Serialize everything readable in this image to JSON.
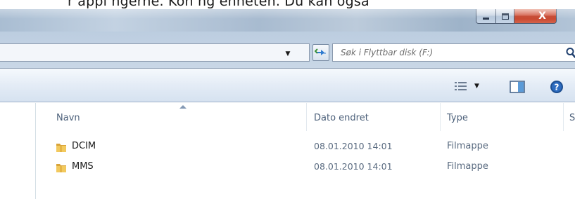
{
  "caption": {
    "text": "r appl ngerne. Kon ng enheten. Du kan også",
    "partial": true
  },
  "window": {
    "minimize_glyph": "minimize-icon",
    "maximize_glyph": "maximize-icon",
    "close_label": "X"
  },
  "address": {
    "path": ""
  },
  "search": {
    "placeholder": "Søk i Flyttbar disk (F:)"
  },
  "toolbar": {
    "views_icon": "views-icon",
    "pane_icon": "preview-pane-icon",
    "help_icon": "help-icon"
  },
  "columns": {
    "name": "Navn",
    "date": "Dato endret",
    "type": "Type",
    "size": "S"
  },
  "files": [
    {
      "name": "DCIM",
      "date": "08.01.2010 14:01",
      "type": "Filmappe"
    },
    {
      "name": "MMS",
      "date": "08.01.2010 14:01",
      "type": "Filmappe"
    }
  ],
  "colors": {
    "title_bar": "#b2c4d7",
    "close_button": "#c23b22",
    "header_text": "#4c607a",
    "folder": "#e8b94a"
  }
}
